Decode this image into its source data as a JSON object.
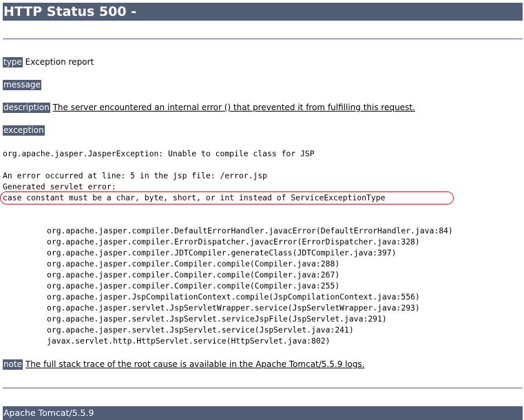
{
  "title": "HTTP Status 500 -",
  "type": {
    "label": "type",
    "value": "Exception report"
  },
  "message": {
    "label": "message",
    "value": ""
  },
  "description": {
    "label": "description",
    "value": "The server encountered an internal error () that prevented it from fulfilling this request."
  },
  "exception": {
    "label": "exception",
    "headline": "org.apache.jasper.JasperException: Unable to compile class for JSP",
    "detail_lines": [
      "An error occurred at line: 5 in the jsp file: /error.jsp",
      "Generated servlet error:",
      "case constant must be a char, byte, short, or int instead of ServiceExceptionType"
    ],
    "stack_trace": [
      "org.apache.jasper.compiler.DefaultErrorHandler.javacError(DefaultErrorHandler.java:84)",
      "org.apache.jasper.compiler.ErrorDispatcher.javacError(ErrorDispatcher.java:328)",
      "org.apache.jasper.compiler.JDTCompiler.generateClass(JDTCompiler.java:397)",
      "org.apache.jasper.compiler.Compiler.compile(Compiler.java:288)",
      "org.apache.jasper.compiler.Compiler.compile(Compiler.java:267)",
      "org.apache.jasper.compiler.Compiler.compile(Compiler.java:255)",
      "org.apache.jasper.JspCompilationContext.compile(JspCompilationContext.java:556)",
      "org.apache.jasper.servlet.JspServletWrapper.service(JspServletWrapper.java:293)",
      "org.apache.jasper.servlet.JspServlet.serviceJspFile(JspServlet.java:291)",
      "org.apache.jasper.servlet.JspServlet.service(JspServlet.java:241)",
      "javax.servlet.http.HttpServlet.service(HttpServlet.java:802)"
    ]
  },
  "note": {
    "label": "note",
    "value": "The full stack trace of the root cause is available in the Apache Tomcat/5.5.9 logs."
  },
  "footer": "Apache Tomcat/5.5.9",
  "colors": {
    "header_bg": "#525D76",
    "header_text": "#ffffff",
    "highlight_outline": "#d02020"
  }
}
